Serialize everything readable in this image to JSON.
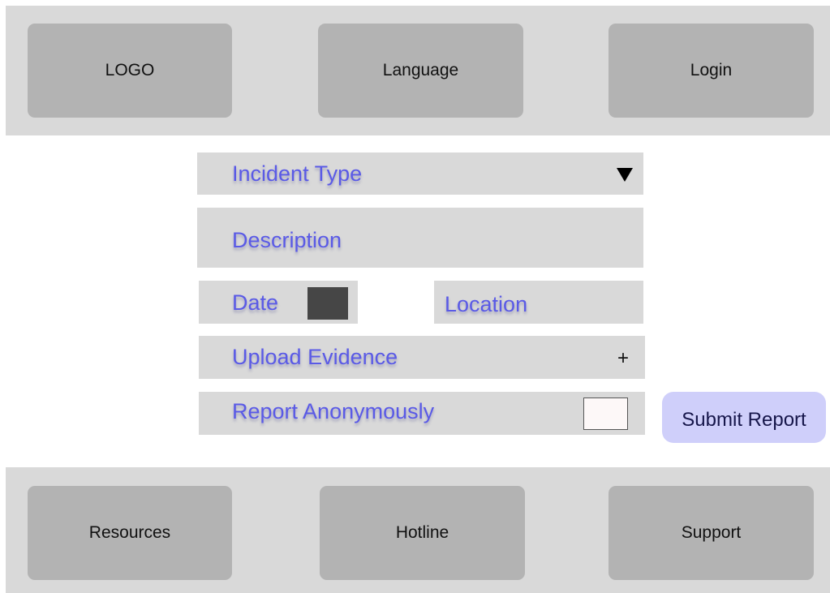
{
  "header": {
    "logo": "LOGO",
    "language": "Language",
    "login": "Login"
  },
  "form": {
    "incident_type": {
      "label": "Incident Type",
      "icon": "triangle-down-icon"
    },
    "description": {
      "label": "Description"
    },
    "date": {
      "label": "Date",
      "icon": "calendar-icon"
    },
    "location": {
      "label": "Location"
    },
    "upload_evidence": {
      "label": "Upload Evidence",
      "icon": "plus-icon",
      "icon_glyph": "+"
    },
    "report_anonymously": {
      "label": "Report Anonymously",
      "checked": false
    },
    "submit": "Submit Report"
  },
  "footer": {
    "resources": "Resources",
    "hotline": "Hotline",
    "support": "Support"
  },
  "colors": {
    "panel": "#d9d9d9",
    "tile": "#b3b3b3",
    "field_label": "#5a5ae6",
    "submit_bg": "#cfcffa"
  }
}
